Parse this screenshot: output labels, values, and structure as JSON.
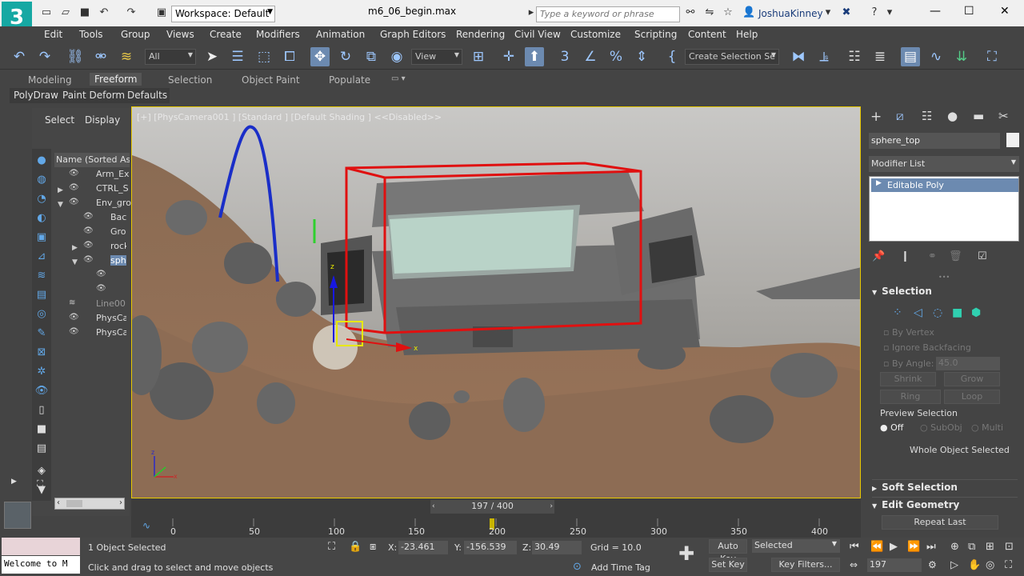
{
  "titlebar": {
    "workspace": "Workspace: Default",
    "filename": "m6_06_begin.max",
    "search_placeholder": "Type a keyword or phrase",
    "user": "JoshuaKinney"
  },
  "menus": [
    "Edit",
    "Tools",
    "Group",
    "Views",
    "Create",
    "Modifiers",
    "Animation",
    "Graph Editors",
    "Rendering",
    "Civil View",
    "Customize",
    "Scripting",
    "Content",
    "Help"
  ],
  "toolbar": {
    "filter": "All",
    "refcoord": "View",
    "named_selection": "Create Selection Se"
  },
  "ribbon": {
    "tabs": [
      "Modeling",
      "Freeform",
      "Selection",
      "Object Paint",
      "Populate"
    ],
    "subtabs": [
      "PolyDraw",
      "Paint Deform",
      "Defaults"
    ]
  },
  "explorer": {
    "tabs": [
      "Select",
      "Display"
    ],
    "header": "Name (Sorted Asc",
    "rows": [
      "Arm_Ex",
      "CTRL_S",
      "Env_gro",
      "Bacl",
      "Grou",
      "rock",
      "sphe",
      "",
      "",
      "Line001",
      "PhysCa",
      "PhysCa"
    ]
  },
  "viewport": {
    "label": "[+] [PhysCamera001 ] [Standard ] [Default Shading ]  <<Disabled>>"
  },
  "cmdpanel": {
    "object_name": "sphere_top",
    "modifier_list": "Modifier List",
    "stack_item": "Editable Poly",
    "selection": {
      "title": "Selection",
      "by_vertex": "By Vertex",
      "ignore_backfacing": "Ignore Backfacing",
      "by_angle": "By Angle:",
      "angle_value": "45.0",
      "shrink": "Shrink",
      "grow": "Grow",
      "ring": "Ring",
      "loop": "Loop",
      "preview_selection": "Preview Selection",
      "off": "Off",
      "subobj": "SubObj",
      "multi": "Multi",
      "whole_object": "Whole Object Selected"
    },
    "soft_selection": "Soft Selection",
    "edit_geometry": "Edit Geometry",
    "repeat_last": "Repeat Last"
  },
  "timeline": {
    "frame": "197 / 400",
    "ticks": [
      "0",
      "50",
      "100",
      "150",
      "200",
      "250",
      "300",
      "350",
      "400"
    ]
  },
  "status": {
    "listener": "Welcome to M",
    "selected": "1 Object Selected",
    "prompt": "Click and drag to select and move objects",
    "x": "-23.461",
    "y": "-156.539",
    "z": "30.49",
    "grid": "Grid = 10.0",
    "add_time_tag": "Add Time Tag",
    "auto_key": "Auto Key",
    "set_key": "Set Key",
    "selected_filter": "Selected",
    "key_filters": "Key Filters...",
    "current_frame": "197"
  }
}
